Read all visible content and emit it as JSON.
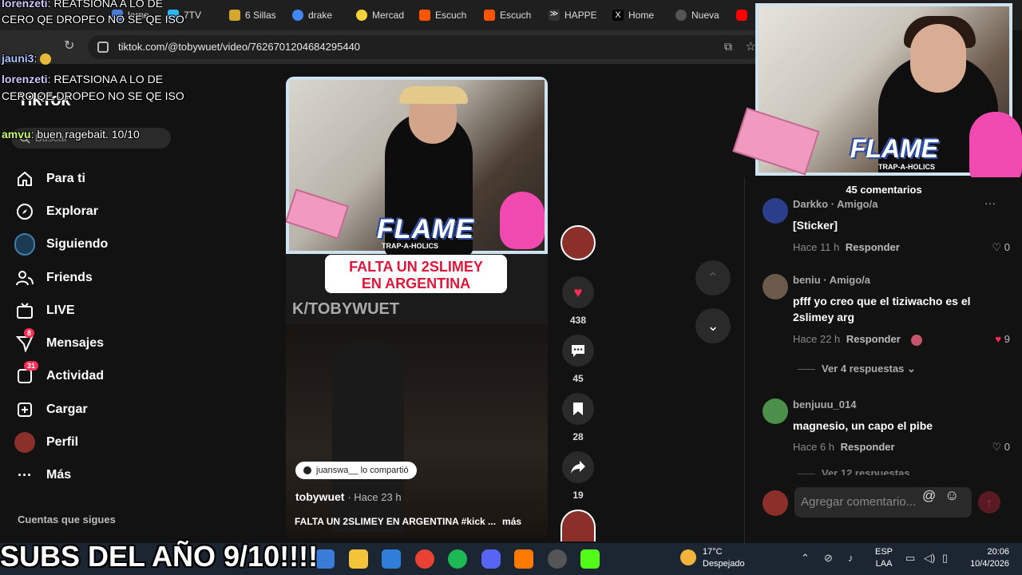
{
  "browser": {
    "tabs": [
      {
        "label": "lerne",
        "color": "#4a7bd8"
      },
      {
        "label": "7TV",
        "color": "#29b6f6"
      },
      {
        "label": "6 Sillas",
        "color": "#d4a72c"
      },
      {
        "label": "drake",
        "color": "#4285f4"
      },
      {
        "label": "Mercad",
        "color": "#f5d33b"
      },
      {
        "label": "Escuch",
        "color": "#ff5500"
      },
      {
        "label": "Escuch",
        "color": "#ff5500"
      },
      {
        "label": "HAPPE",
        "color": "#ffffff"
      },
      {
        "label": "Home",
        "color": "#ffffff"
      },
      {
        "label": "Nueva",
        "color": "#bbbbbb"
      }
    ],
    "url": "tiktok.com/@tobywuet/video/7626701204684295440"
  },
  "chat": [
    {
      "user": "lorenzeti",
      "text": ": REATSIONA A LO DE",
      "text2": "CERO QE DROPEO NO SE QE ISO"
    },
    {
      "user": "jauni3",
      "text": ":"
    },
    {
      "user": "lorenzeti",
      "text": ": REATSIONA A LO DE",
      "text2": "CERO QE DROPEO NO SE QE ISO"
    },
    {
      "user": "amvu",
      "text": ": buen ragebait. 10/10"
    }
  ],
  "tiktok": {
    "logo": "TikTok",
    "search_placeholder": "Buscar",
    "nav": [
      {
        "label": "Para ti",
        "icon": "home-icon"
      },
      {
        "label": "Explorar",
        "icon": "compass-icon"
      },
      {
        "label": "Siguiendo",
        "icon": "following-icon"
      },
      {
        "label": "Friends",
        "icon": "friends-icon"
      },
      {
        "label": "LIVE",
        "icon": "live-icon"
      },
      {
        "label": "Mensajes",
        "icon": "messages-icon",
        "badge": "8"
      },
      {
        "label": "Actividad",
        "icon": "activity-icon",
        "badge": "31"
      },
      {
        "label": "Cargar",
        "icon": "upload-icon"
      },
      {
        "label": "Perfil",
        "icon": "profile-icon"
      },
      {
        "label": "Más",
        "icon": "more-icon"
      }
    ],
    "following_header": "Cuentas que sigues"
  },
  "video": {
    "flame_text": "FLAME",
    "flame_sub": "TRAP-A-HOLICS",
    "caption_line1": "FALTA UN 2SLIMEY",
    "caption_line2": "EN ARGENTINA",
    "watermark": "K/TOBYWUET",
    "shared_by": "juanswa__ lo compartió",
    "author": "tobywuet",
    "author_ago": "· Hace 23 h",
    "description": "FALTA UN 2SLIMEY EN ARGENTINA #kick ...",
    "more": "más"
  },
  "actions": {
    "likes": "438",
    "comments": "45",
    "saves": "28",
    "shares": "19"
  },
  "comments": {
    "title": "45 comentarios",
    "items": [
      {
        "name": "Darkko · Amigo/a",
        "text": "[Sticker]",
        "time": "Hace 11 h",
        "reply": "Responder",
        "likes": "0",
        "liked": false
      },
      {
        "name": "beniu · Amigo/a",
        "text": "pfff yo creo que el tiziwacho es el 2slimey arg",
        "time": "Hace 22 h",
        "reply": "Responder",
        "likes": "9",
        "liked": true
      },
      {
        "name": "benjuuu_014",
        "text": "magnesio, un capo el pibe",
        "time": "Hace 6 h",
        "reply": "Responder",
        "likes": "0",
        "liked": false
      }
    ],
    "view_replies": "Ver 4 respuestas",
    "view_more_replies": "Ver 12 respuestas",
    "composer_placeholder": "Agregar comentario..."
  },
  "webcam": {
    "flame_text": "FLAME",
    "flame_sub": "TRAP-A-HOLICS"
  },
  "banner": "SUBS DEL AÑO 9/10!!!!",
  "taskbar": {
    "weather_temp": "17°C",
    "weather_desc": "Despejado",
    "lang_top": "ESP",
    "lang_bottom": "LAA",
    "time": "20:06",
    "date": "10/4/2026"
  }
}
